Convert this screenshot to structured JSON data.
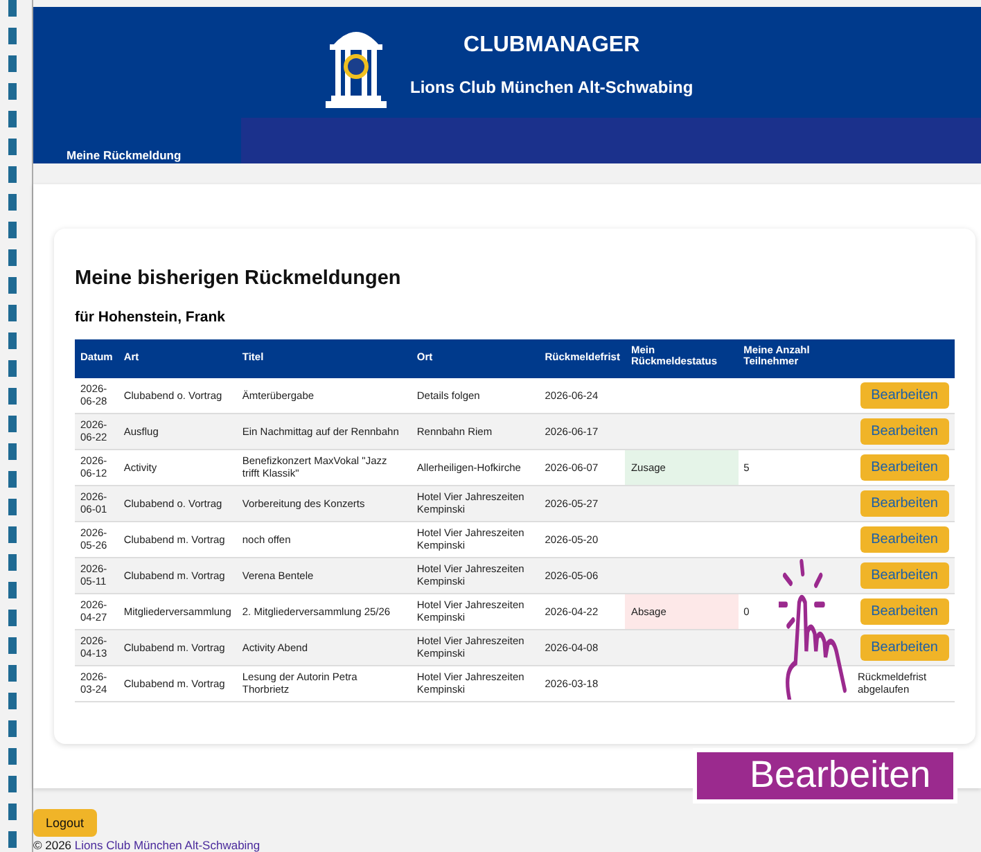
{
  "header": {
    "title": "CLUBMANAGER",
    "subtitle": "Lions Club München Alt-Schwabing"
  },
  "nav": {
    "items": [
      {
        "label": "Meine Rückmeldung",
        "selected": true
      }
    ]
  },
  "page": {
    "heading": "Meine bisherigen Rückmeldungen",
    "member": "für Hohenstein, Frank"
  },
  "table": {
    "columns": [
      "Datum",
      "Art",
      "Titel",
      "Ort",
      "Rückmeldefrist",
      "Mein Rückmeldestatus",
      "Meine Anzahl Teilnehmer"
    ],
    "rows": [
      {
        "date": "2026-06-28",
        "type": "Clubabend o. Vortrag",
        "title": "Ämterübergabe",
        "place": "Details folgen",
        "deadline": "2026-06-24",
        "action": {
          "kind": "button",
          "label": "Bearbeiten"
        }
      },
      {
        "date": "2026-06-22",
        "type": "Ausflug",
        "title": "Ein Nachmittag auf der Rennbahn",
        "place": "Rennbahn Riem",
        "deadline": "2026-06-17",
        "action": {
          "kind": "button",
          "label": "Bearbeiten"
        }
      },
      {
        "date": "2026-06-12",
        "type": "Activity",
        "title": "Benefizkonzert MaxVokal \"Jazz trifft Klassik\"",
        "place": "Allerheiligen-Hofkirche",
        "deadline": "2026-06-07",
        "status": {
          "kind": "accepted",
          "label": "Zusage"
        },
        "count": "5",
        "action": {
          "kind": "button",
          "label": "Bearbeiten"
        }
      },
      {
        "date": "2026-06-01",
        "type": "Clubabend o. Vortrag",
        "title": "Vorbereitung des Konzerts",
        "place": "Hotel Vier Jahreszeiten Kempinski",
        "deadline": "2026-05-27",
        "action": {
          "kind": "button",
          "label": "Bearbeiten"
        }
      },
      {
        "date": "2026-05-26",
        "type": "Clubabend m. Vortrag",
        "title": "noch offen",
        "place": "Hotel Vier Jahreszeiten Kempinski",
        "deadline": "2026-05-20",
        "action": {
          "kind": "button",
          "label": "Bearbeiten"
        }
      },
      {
        "date": "2026-05-11",
        "type": "Clubabend m. Vortrag",
        "title": "Verena Bentele",
        "place": "Hotel Vier Jahreszeiten Kempinski",
        "deadline": "2026-05-06",
        "action": {
          "kind": "button",
          "label": "Bearbeiten"
        }
      },
      {
        "date": "2026-04-27",
        "type": "Mitgliederversammlung",
        "title": "2. Mitgliederversammlung 25/26",
        "place": "Hotel Vier Jahreszeiten Kempinski",
        "deadline": "2026-04-22",
        "status": {
          "kind": "declined",
          "label": "Absage"
        },
        "count": "0",
        "action": {
          "kind": "button",
          "label": "Bearbeiten"
        }
      },
      {
        "date": "2026-04-13",
        "type": "Clubabend m. Vortrag",
        "title": "Activity Abend",
        "place": "Hotel Vier Jahreszeiten Kempinski",
        "deadline": "2026-04-08",
        "action": {
          "kind": "button",
          "label": "Bearbeiten"
        }
      },
      {
        "date": "2026-03-24",
        "type": "Clubabend m. Vortrag",
        "title": "Lesung der Autorin Petra Thorbrietz",
        "place": "Hotel Vier Jahreszeiten Kempinski",
        "deadline": "2026-03-18",
        "action": {
          "kind": "text",
          "label": "Rückmeldefrist abgelaufen"
        }
      }
    ]
  },
  "logout": "Logout",
  "footer": {
    "copyright": "© 2026",
    "link": "Lions Club München Alt-Schwabing"
  },
  "callout": {
    "label": "Bearbeiten"
  }
}
